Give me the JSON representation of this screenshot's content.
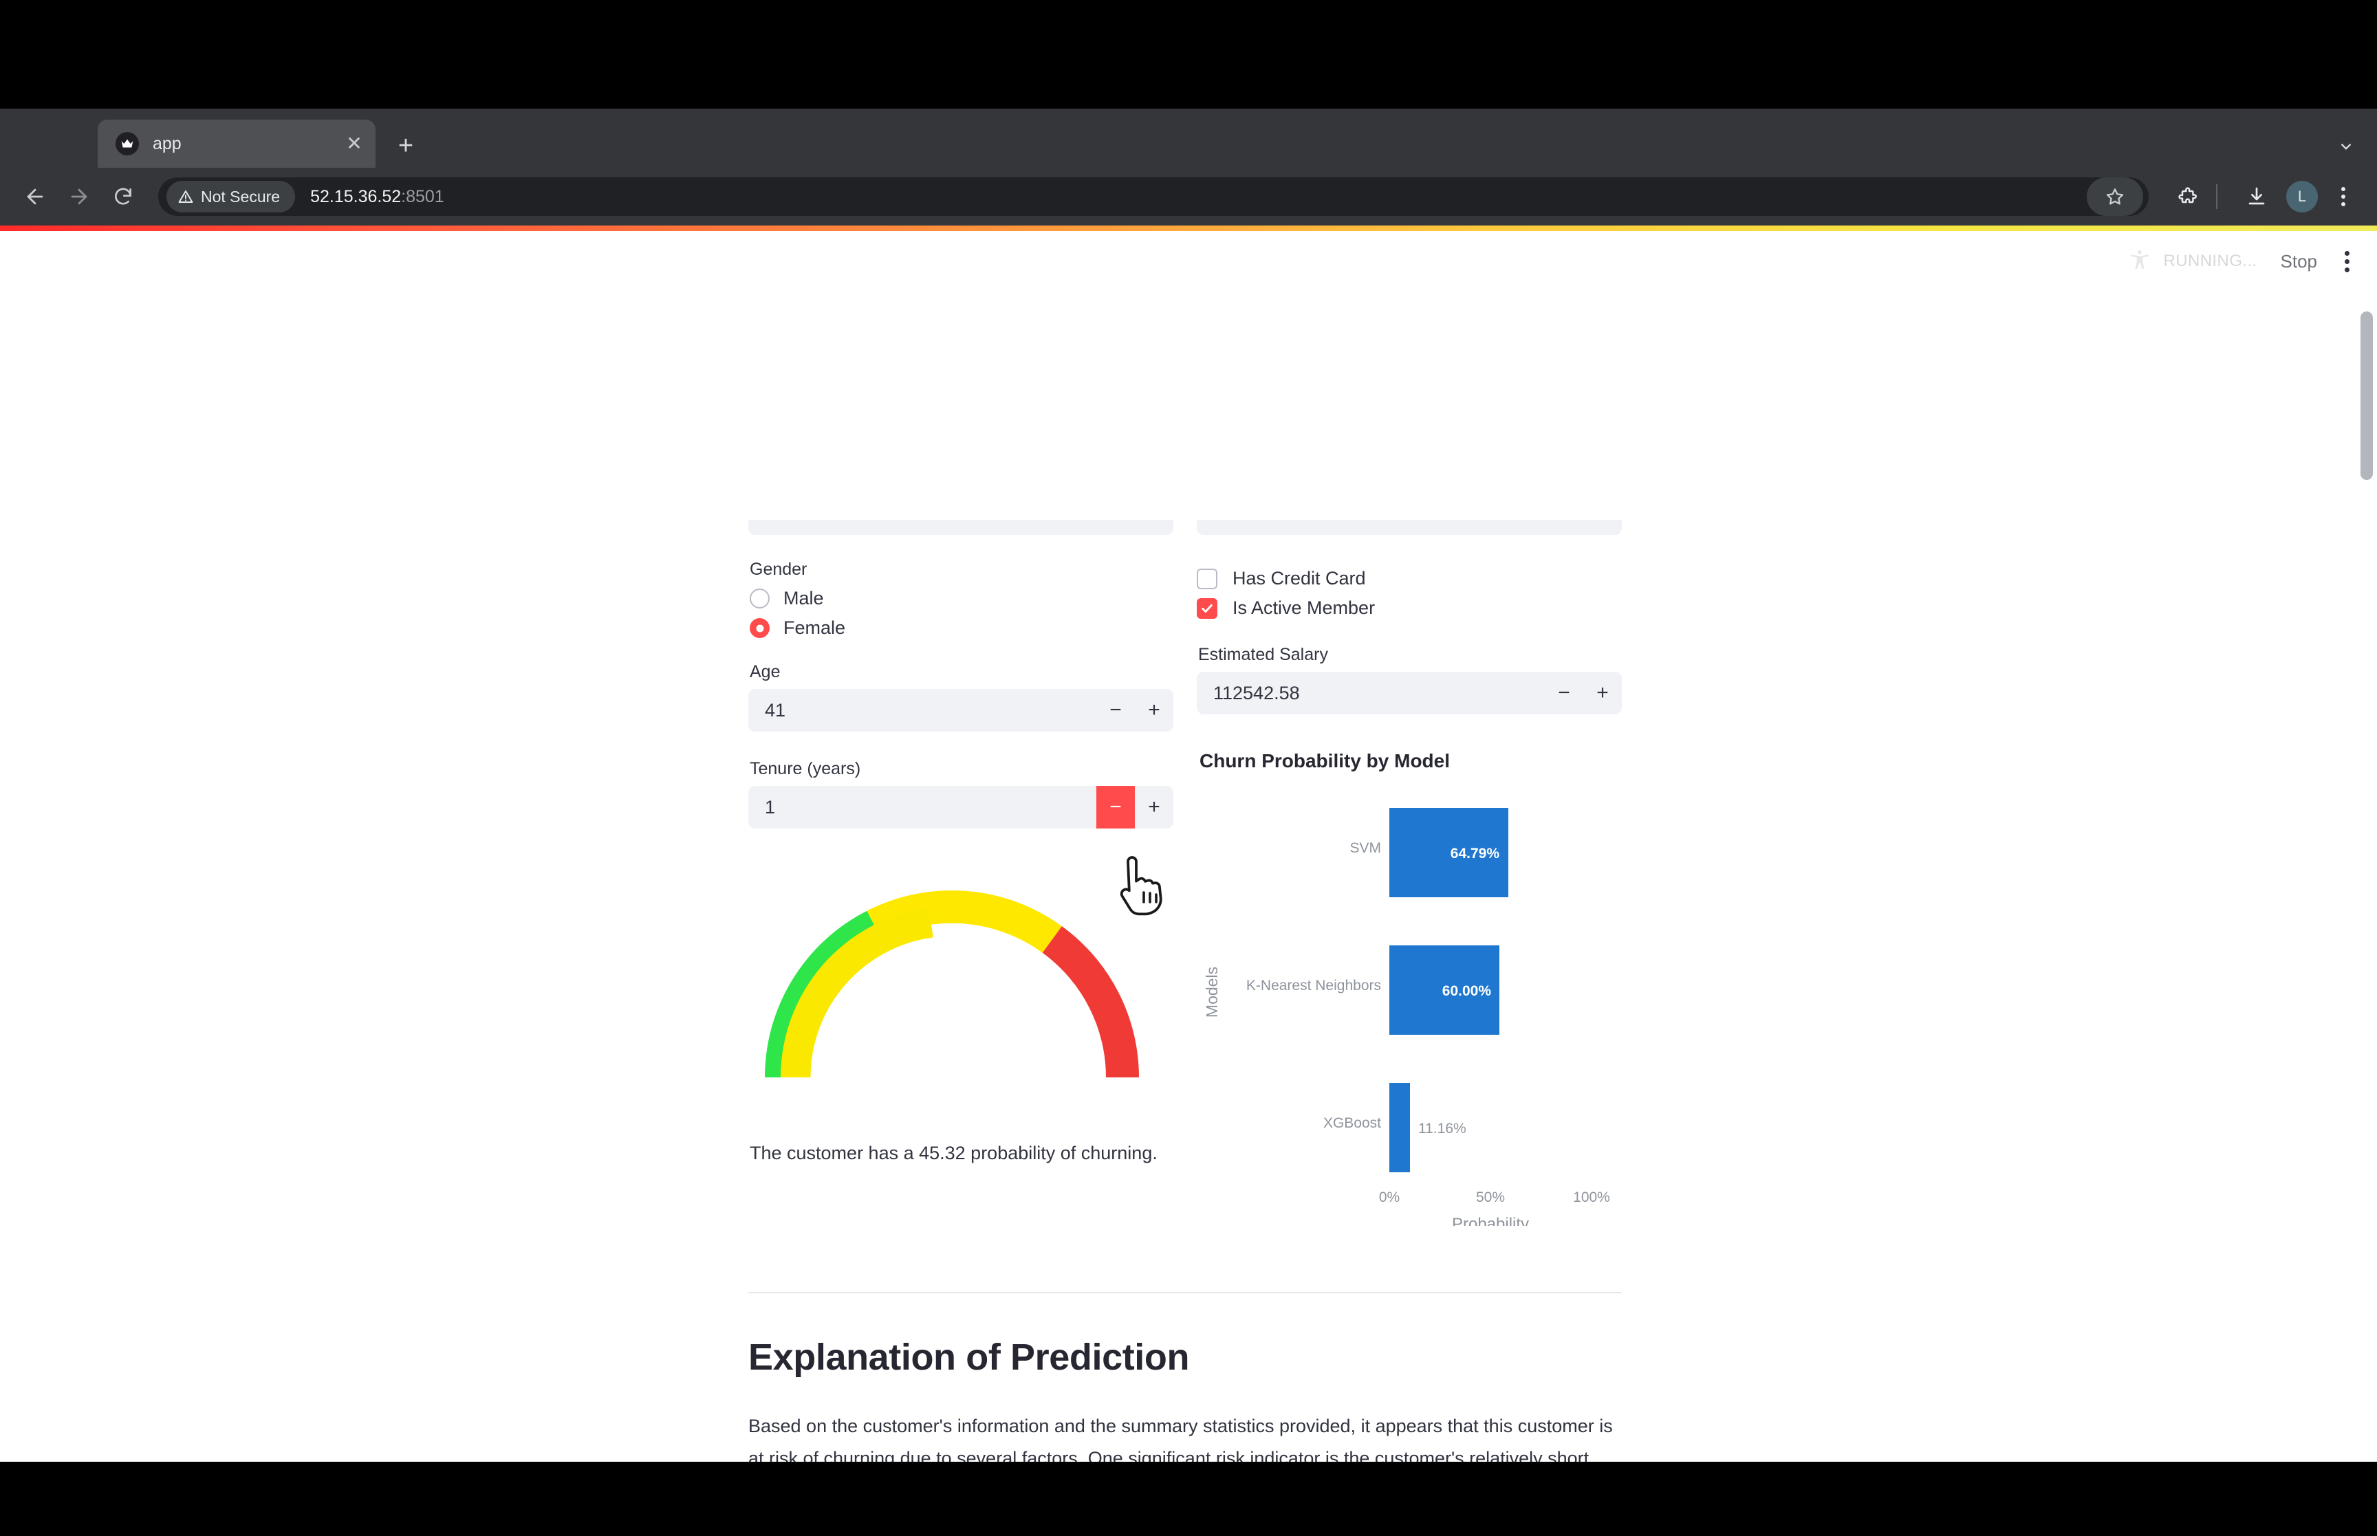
{
  "browser": {
    "tab": {
      "title": "app",
      "favicon": "crown-icon",
      "close": "✕"
    },
    "new_tab": "+",
    "back": "←",
    "forward": "→",
    "reload": "⟳",
    "security_label": "Not Secure",
    "url_host": "52.15.36.52",
    "url_port": ":8501",
    "avatar_initial": "L",
    "icons": {
      "star": "bookmark-star-icon",
      "extensions": "extensions-puzzle-icon",
      "download": "download-icon",
      "menu": "kebab-menu-icon",
      "tabstrip_collapse": "chevron-down-icon"
    }
  },
  "app_status": {
    "running_label": "RUNNING...",
    "stop_label": "Stop",
    "menu": "kebab-menu-icon",
    "accessibility": "accessibility-icon"
  },
  "form": {
    "gender": {
      "label": "Gender",
      "options": [
        "Male",
        "Female"
      ],
      "selected": "Female"
    },
    "age": {
      "label": "Age",
      "value": "41",
      "minus": "−",
      "plus": "+"
    },
    "tenure": {
      "label": "Tenure (years)",
      "value": "1",
      "minus": "−",
      "plus": "+"
    },
    "has_credit_card": {
      "label": "Has Credit Card",
      "checked": false
    },
    "is_active_member": {
      "label": "Is Active Member",
      "checked": true
    },
    "estimated_salary": {
      "label": "Estimated Salary",
      "value": "112542.58",
      "minus": "−",
      "plus": "+"
    }
  },
  "gauge": {
    "caption": "The customer has a 45.32 probability of churning.",
    "value": 45.32,
    "min": 0,
    "max": 100,
    "steps": [
      {
        "range": [
          0,
          35
        ],
        "color": "#2ee54a"
      },
      {
        "range": [
          35,
          70
        ],
        "color": "#ffe800"
      },
      {
        "range": [
          70,
          100
        ],
        "color": "#f03a36"
      }
    ],
    "inner_bar_color": "#fbe800",
    "inner_bar_value": 45.32
  },
  "chart_data": {
    "type": "bar",
    "orientation": "horizontal",
    "title": "Churn Probability by Model",
    "xlabel": "Probability",
    "ylabel": "Models",
    "categories": [
      "SVM",
      "K-Nearest Neighbors",
      "XGBoost"
    ],
    "values": [
      64.79,
      60.0,
      11.16
    ],
    "value_labels": [
      "64.79%",
      "60.00%",
      "11.16%"
    ],
    "xlim": [
      0,
      100
    ],
    "xticks": [
      0,
      50,
      100
    ],
    "xtick_labels": [
      "0%",
      "50%",
      "100%"
    ],
    "bar_color": "#1f77d0",
    "grid": false,
    "legend": false
  },
  "explanation": {
    "heading": "Explanation of Prediction",
    "paragraph": "Based on the customer's information and the summary statistics provided, it appears that this customer is at risk of churning due to several factors. One significant risk indicator is the customer's relatively short tenure with the company, with a tenure of 2 years, which falls within the 18-44 month range that separates low churners from churners. Furthermore, the customer has only one product with the bank, which may"
  }
}
